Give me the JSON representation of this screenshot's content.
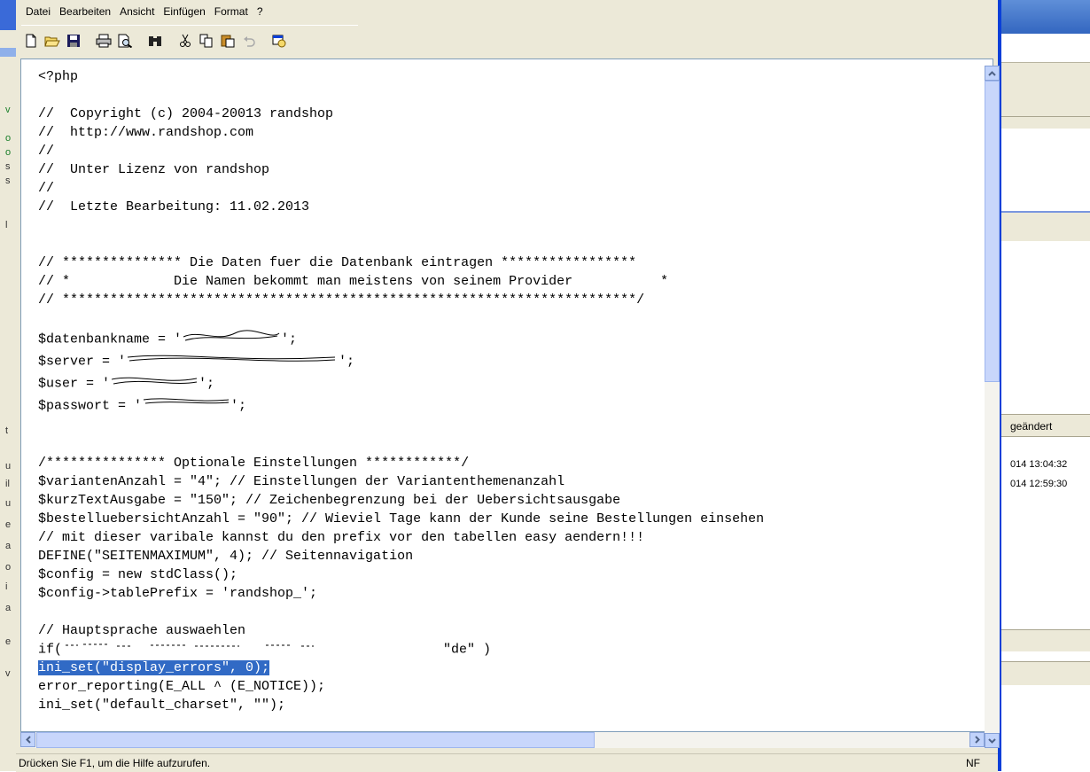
{
  "menu": {
    "items": [
      "Datei",
      "Bearbeiten",
      "Ansicht",
      "Einfügen",
      "Format",
      "?"
    ]
  },
  "toolbar": {
    "icons": [
      "new-document-icon",
      "open-folder-icon",
      "save-disk-icon",
      "print-icon",
      "print-preview-icon",
      "find-binoculars-icon",
      "cut-scissors-icon",
      "copy-icon",
      "paste-icon",
      "undo-icon",
      "insert-date-icon"
    ]
  },
  "editor": {
    "lines": [
      "<?php",
      "",
      "//  Copyright (c) 2004-20013 randshop",
      "//  http://www.randshop.com",
      "//",
      "//  Unter Lizenz von randshop",
      "//",
      "//  Letzte Bearbeitung: 11.02.2013",
      "",
      "",
      "// *************** Die Daten fuer die Datenbank eintragen *****************",
      "// *             Die Namen bekommt man meistens von seinem Provider           *",
      "// ************************************************************************/",
      "",
      "$datenbankname = '",
      "$server = '",
      "$user = '",
      "$passwort = '",
      "",
      "",
      "/*************** Optionale Einstellungen ************/",
      "$variantenAnzahl = \"4\"; // Einstellungen der Variantenthemenanzahl",
      "$kurzTextAusgabe = \"150\"; // Zeichenbegrenzung bei der Uebersichtsausgabe",
      "$bestelluebersichtAnzahl = \"90\"; // Wieviel Tage kann der Kunde seine Bestellungen einsehen",
      "// mit dieser varibale kannst du den prefix vor den tabellen easy aendern!!!",
      "DEFINE(\"SEITENMAXIMUM\", 4); // Seitennavigation",
      "$config = new stdClass();",
      "$config->tablePrefix = 'randshop_';",
      "",
      "// Hauptsprache auswaehlen",
      "if(",
      "ini_set(\"display_errors\", 0);",
      "error_reporting(E_ALL ^ (E_NOTICE));",
      "ini_set(\"default_charset\", \"\");"
    ],
    "redacted_suffix": "';",
    "partial_if_tail": "\"de\" )",
    "highlighted_line_index": 31
  },
  "status": {
    "help_text": "Drücken Sie F1, um die Hilfe aufzurufen.",
    "mode": "NF"
  },
  "background_window": {
    "header_label": "geändert",
    "rows": [
      "014 13:04:32",
      "014 12:59:30"
    ]
  },
  "colors": {
    "selection": "#316ac5",
    "window_border": "#0a3fd8",
    "chrome": "#ece9d8"
  }
}
